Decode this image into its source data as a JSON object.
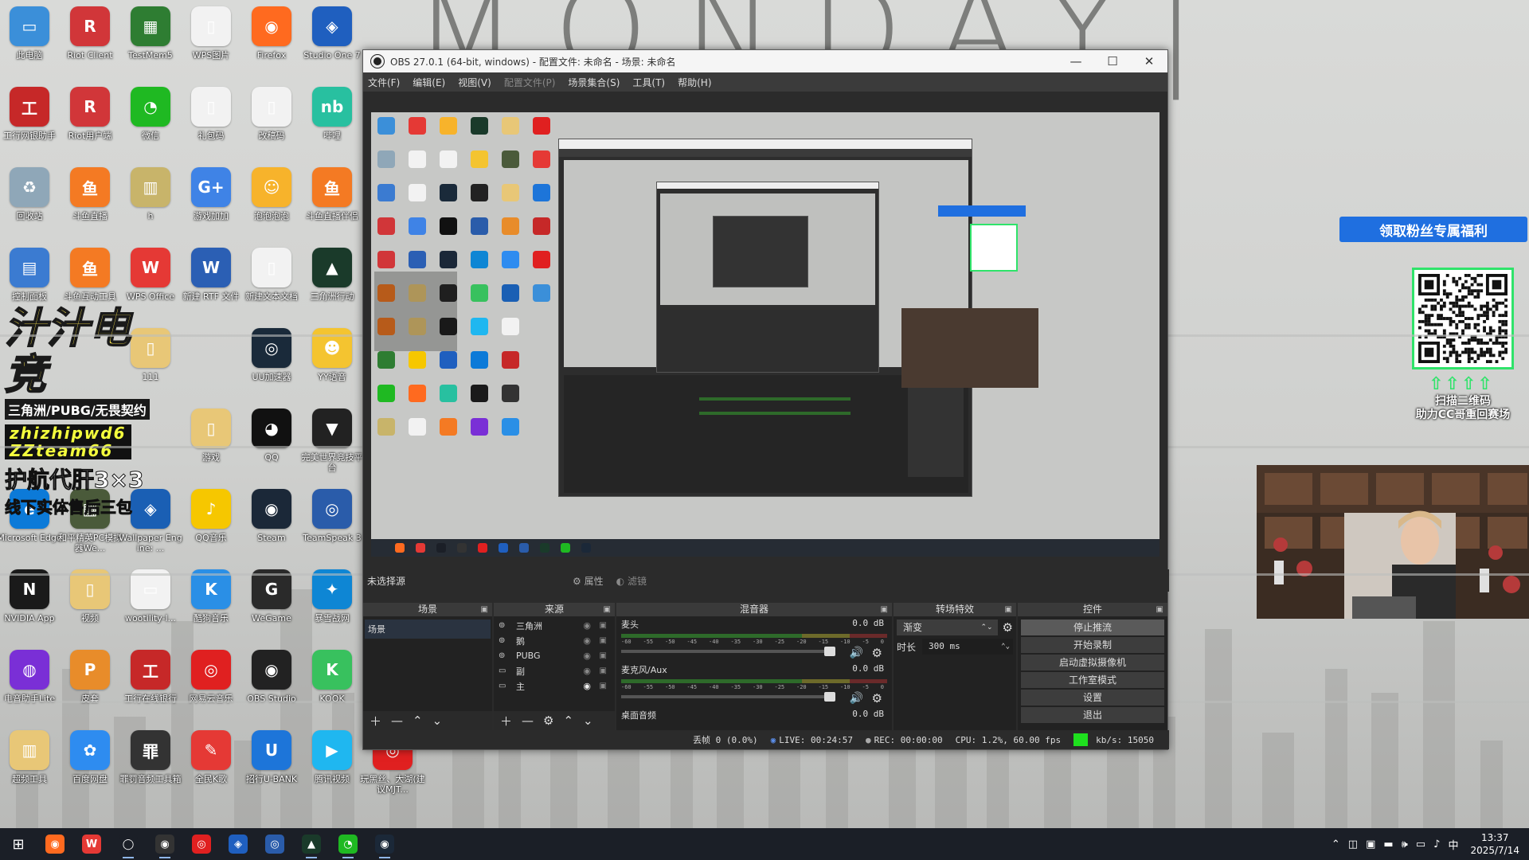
{
  "wallpaper": {
    "word": "MONDAY|"
  },
  "desktop_icons": [
    {
      "label": "此电脑",
      "glyph": "▭",
      "color": "#3b8fd9"
    },
    {
      "label": "回收站",
      "glyph": "♻",
      "color": "#8fa7b8"
    },
    {
      "label": "控制面板",
      "glyph": "▤",
      "color": "#3b7bd1"
    },
    {
      "label": "Riot Client",
      "glyph": "R",
      "color": "#d13639"
    },
    {
      "label": "Riot用户端",
      "glyph": "R",
      "color": "#d13639"
    },
    {
      "label": "斗鱼直播",
      "glyph": "鱼",
      "color": "#f47a23"
    },
    {
      "label": "斗鱼互动工具",
      "glyph": "鱼",
      "color": "#f47a23"
    },
    {
      "label": "TestMem5",
      "glyph": "▦",
      "color": "#2e7d32"
    },
    {
      "label": "微信",
      "glyph": "◔",
      "color": "#1fb922"
    },
    {
      "label": "h",
      "glyph": "▥",
      "color": "#c8b46a"
    },
    {
      "label": "WPS Office",
      "glyph": "W",
      "color": "#e53935"
    },
    {
      "label": "WPS图片",
      "glyph": "▯",
      "color": "#f2f2f2"
    },
    {
      "label": "礼包码",
      "glyph": "▯",
      "color": "#f2f2f2"
    },
    {
      "label": "游戏加加",
      "glyph": "G+",
      "color": "#3f83e6"
    },
    {
      "label": "新建 RTF 文件",
      "glyph": "W",
      "color": "#2b5fb4"
    },
    {
      "label": "111",
      "glyph": "▯",
      "color": "#e8c777"
    },
    {
      "label": "游戏",
      "glyph": "▯",
      "color": "#e8c777"
    },
    {
      "label": "QQ音乐",
      "glyph": "♪",
      "color": "#f6c700"
    },
    {
      "label": "Firefox",
      "glyph": "◉",
      "color": "#ff6a1f"
    },
    {
      "label": "改稿码",
      "glyph": "▯",
      "color": "#f2f2f2"
    },
    {
      "label": "泡泡泡泡",
      "glyph": "☺",
      "color": "#f7b32b"
    },
    {
      "label": "新建文本文档",
      "glyph": "▯",
      "color": "#f2f2f2"
    },
    {
      "label": "UU加速器",
      "glyph": "◎",
      "color": "#1a2a3a"
    },
    {
      "label": "QQ",
      "glyph": "◕",
      "color": "#111111"
    },
    {
      "label": "Steam",
      "glyph": "◉",
      "color": "#1b2838"
    },
    {
      "label": "WeGame",
      "glyph": "G",
      "color": "#2a2a2a"
    },
    {
      "label": "OBS Studio",
      "glyph": "◉",
      "color": "#222222"
    },
    {
      "label": "Studio One 7",
      "glyph": "◈",
      "color": "#1f5fbf"
    },
    {
      "label": "哔哩",
      "glyph": "nb",
      "color": "#28c0a0"
    },
    {
      "label": "斗鱼直播伴侣",
      "glyph": "鱼",
      "color": "#f47a23"
    },
    {
      "label": "三角洲行动",
      "glyph": "▲",
      "color": "#1a3a2a"
    },
    {
      "label": "YY语音",
      "glyph": "☻",
      "color": "#f4c430"
    },
    {
      "label": "完美世界竞技平台",
      "glyph": "▼",
      "color": "#222222"
    },
    {
      "label": "TeamSpeak 3",
      "glyph": "◎",
      "color": "#2a5caa"
    },
    {
      "label": "暴雪战网",
      "glyph": "✦",
      "color": "#0e86d4"
    },
    {
      "label": "KOOK",
      "glyph": "K",
      "color": "#38c15e"
    },
    {
      "label": "腾讯视频",
      "glyph": "▶",
      "color": "#1fb7f0"
    },
    {
      "label": "Microsoft Edge",
      "glyph": "e",
      "color": "#0c7ad8"
    },
    {
      "label": "NVIDIA App",
      "glyph": "N",
      "color": "#1a1a1a"
    },
    {
      "label": "电音助手Lite",
      "glyph": "◍",
      "color": "#7a2fd6"
    },
    {
      "label": "超频工具",
      "glyph": "▥",
      "color": "#e8c777"
    },
    {
      "label": "和平精英PC模拟器We...",
      "glyph": "▦",
      "color": "#4a5a3a"
    },
    {
      "label": "视频",
      "glyph": "▯",
      "color": "#e8c777"
    },
    {
      "label": "皮套",
      "glyph": "P",
      "color": "#e88c2a"
    },
    {
      "label": "百度网盘",
      "glyph": "✿",
      "color": "#2e8cf0"
    },
    {
      "label": "Wallpaper Engine: ...",
      "glyph": "◈",
      "color": "#1a5fb4"
    },
    {
      "label": "wootility-l...",
      "glyph": "▭",
      "color": "#f2f2f2"
    },
    {
      "label": "工行在线银行",
      "glyph": "工",
      "color": "#c62828"
    },
    {
      "label": "罪罚音频工具箱",
      "glyph": "罪",
      "color": "#333333"
    },
    {
      "label": "酷狗音乐",
      "glyph": "K",
      "color": "#2a8fe6"
    },
    {
      "label": "网易云音乐",
      "glyph": "◎",
      "color": "#e02020"
    },
    {
      "label": "全民K歌",
      "glyph": "✎",
      "color": "#e53935"
    },
    {
      "label": "招行U-BANK",
      "glyph": "U",
      "color": "#1d75d9"
    },
    {
      "label": "工行网银助手",
      "glyph": "工",
      "color": "#c62828"
    },
    {
      "label": "玩黑丝、大湖(建议MJT...",
      "glyph": "◎",
      "color": "#e02020"
    }
  ],
  "promo": {
    "big": "汁汁电竞",
    "sub": "三角洲/PUBG/无畏契约",
    "wechat_lines": [
      "zhizhipwd6",
      "ZZteam66"
    ],
    "guard": "护航代肝3×3",
    "guard_sub": "线下实体售后三包"
  },
  "widgets": {
    "fan_banner": "领取粉丝专属福利",
    "qr_arrows": "⇧⇧⇧⇧",
    "qr_text": "扫描二维码\n助力CC哥重回赛场"
  },
  "obs": {
    "title": "OBS 27.0.1 (64-bit, windows) - 配置文件: 未命名 - 场景: 未命名",
    "menu": [
      {
        "label": "文件(F)",
        "disabled": false
      },
      {
        "label": "编辑(E)",
        "disabled": false
      },
      {
        "label": "视图(V)",
        "disabled": false
      },
      {
        "label": "配置文件(P)",
        "disabled": true
      },
      {
        "label": "场景集合(S)",
        "disabled": false
      },
      {
        "label": "工具(T)",
        "disabled": false
      },
      {
        "label": "帮助(H)",
        "disabled": false
      }
    ],
    "no_source": "未选择源",
    "properties": "属性",
    "filters": "滤镜",
    "docks": {
      "scenes": "场景",
      "sources": "来源",
      "mixer": "混音器",
      "transitions": "转场特效",
      "controls": "控件"
    },
    "scene_list": [
      "场景"
    ],
    "source_list": [
      {
        "name": "三角洲",
        "type": "game"
      },
      {
        "name": "鹅",
        "type": "game"
      },
      {
        "name": "PUBG",
        "type": "game"
      },
      {
        "name": "副",
        "type": "display"
      },
      {
        "name": "主",
        "type": "display"
      }
    ],
    "mixer_channels": [
      {
        "name": "麦头",
        "db": "0.0 dB"
      },
      {
        "name": "麦克风/Aux",
        "db": "0.0 dB"
      },
      {
        "name": "桌面音频",
        "db": "0.0 dB"
      }
    ],
    "meter_ticks": [
      "-60",
      "-55",
      "-50",
      "-45",
      "-40",
      "-35",
      "-30",
      "-25",
      "-20",
      "-15",
      "-10",
      "-5",
      "0"
    ],
    "transition": {
      "type": "渐变",
      "duration_label": "时长",
      "duration": "300 ms"
    },
    "controls": [
      "停止推流",
      "开始录制",
      "启动虚拟摄像机",
      "工作室模式",
      "设置",
      "退出"
    ],
    "status": {
      "dropped": "丢帧 0 (0.0%)",
      "live": "LIVE: 00:24:57",
      "rec": "REC: 00:00:00",
      "cpu": "CPU: 1.2%, 60.00 fps",
      "kbps": "kb/s: 15050"
    }
  },
  "taskbar": {
    "apps": [
      {
        "name": "firefox",
        "glyph": "◉",
        "color": "#ff6a1f",
        "open": false
      },
      {
        "name": "wps",
        "glyph": "W",
        "color": "#e53935",
        "open": false
      },
      {
        "name": "obs-like",
        "glyph": "◯",
        "color": "#1b1f27",
        "open": true
      },
      {
        "name": "obs",
        "glyph": "◉",
        "color": "#333333",
        "open": true
      },
      {
        "name": "netease",
        "glyph": "◎",
        "color": "#e02020",
        "open": false
      },
      {
        "name": "studio-one",
        "glyph": "◈",
        "color": "#1f5fbf",
        "open": false
      },
      {
        "name": "teamspeak",
        "glyph": "◎",
        "color": "#2a5caa",
        "open": false
      },
      {
        "name": "delta",
        "glyph": "▲",
        "color": "#1a3a2a",
        "open": true
      },
      {
        "name": "wechat",
        "glyph": "◔",
        "color": "#1fb922",
        "open": true
      },
      {
        "name": "steam",
        "glyph": "◉",
        "color": "#1b2838",
        "open": true
      }
    ],
    "tray": {
      "ime": "中",
      "time": "13:37",
      "date": "2025/7/14"
    }
  }
}
